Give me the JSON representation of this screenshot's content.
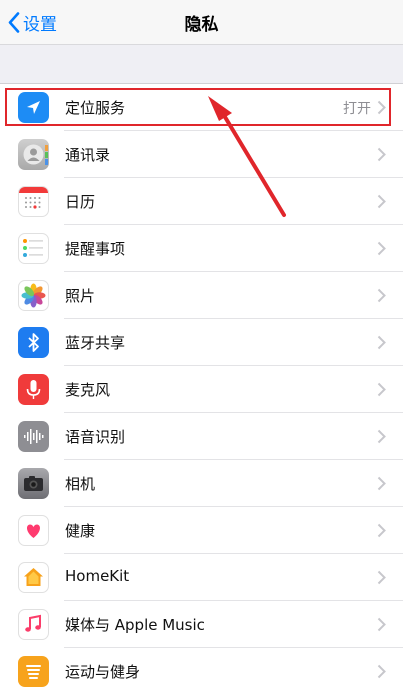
{
  "nav": {
    "back_label": "设置",
    "title": "隐私"
  },
  "rows": [
    {
      "label": "定位服务",
      "value": "打开",
      "icon": "location-arrow-icon"
    },
    {
      "label": "通讯录",
      "icon": "contacts-icon"
    },
    {
      "label": "日历",
      "icon": "calendar-icon"
    },
    {
      "label": "提醒事项",
      "icon": "reminders-icon"
    },
    {
      "label": "照片",
      "icon": "photos-icon"
    },
    {
      "label": "蓝牙共享",
      "icon": "bluetooth-icon"
    },
    {
      "label": "麦克风",
      "icon": "microphone-icon"
    },
    {
      "label": "语音识别",
      "icon": "speech-recognition-icon"
    },
    {
      "label": "相机",
      "icon": "camera-icon"
    },
    {
      "label": "健康",
      "icon": "health-heart-icon"
    },
    {
      "label": "HomeKit",
      "icon": "homekit-house-icon"
    },
    {
      "label": "媒体与 Apple Music",
      "icon": "music-note-icon"
    },
    {
      "label": "运动与健身",
      "icon": "motion-fitness-icon"
    }
  ],
  "colors": {
    "accent": "#007aff",
    "annotation_red": "#e0262b",
    "background": "#efeff4"
  }
}
